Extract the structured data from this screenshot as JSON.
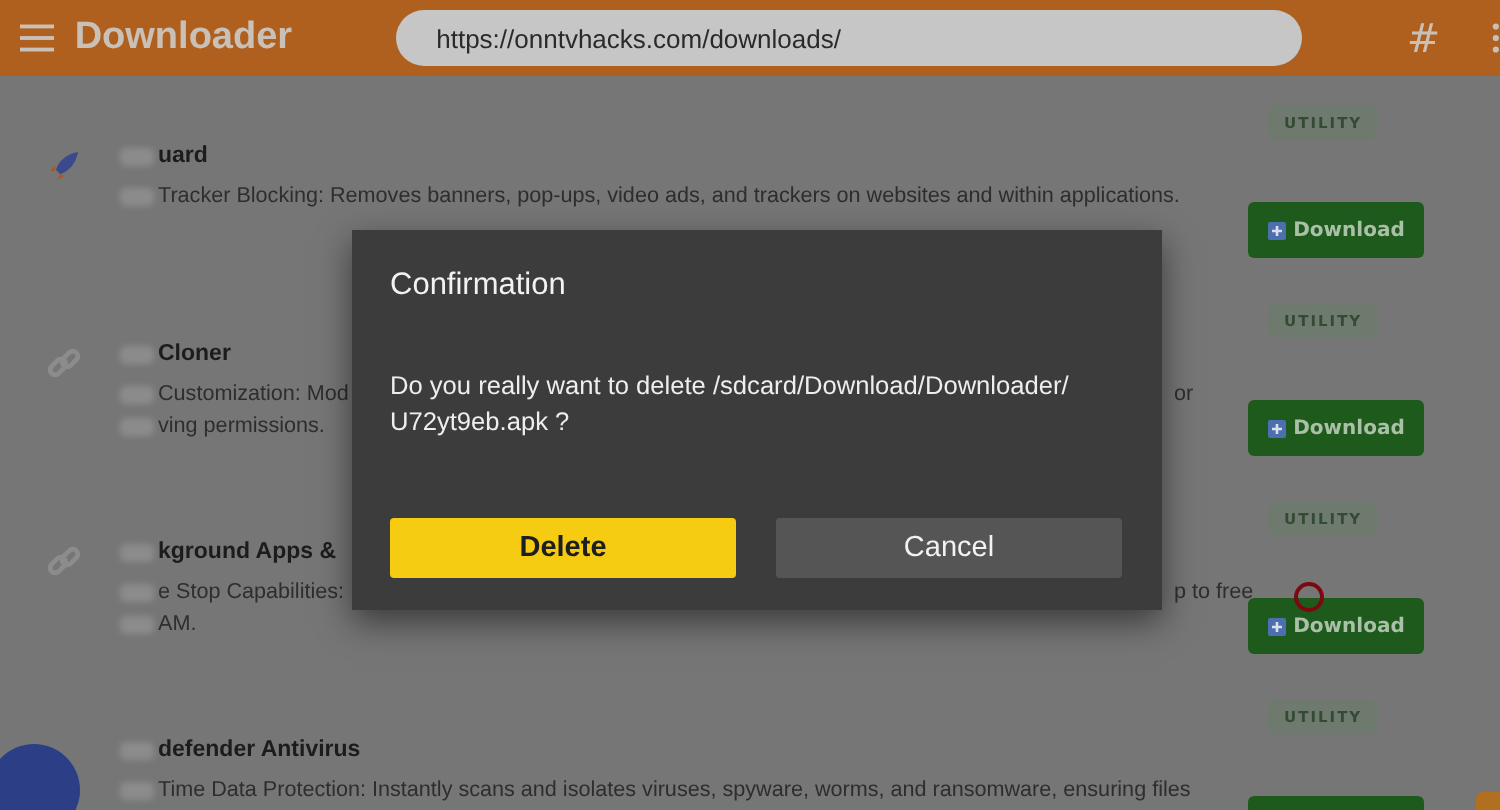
{
  "header": {
    "title": "Downloader",
    "url": "https://onntvhacks.com/downloads/",
    "hash": "#"
  },
  "apps": [
    {
      "kind": "rocket",
      "name": "uard",
      "desc_left": [
        "Tracker Blocking: Removes banners, pop-ups, video ads, and trackers on websites and within applications."
      ],
      "tag": "UTILITY",
      "button": "Download"
    },
    {
      "kind": "link",
      "name": "Cloner",
      "desc_left": [
        "Customization: Mod",
        "ving permissions."
      ],
      "desc_right": [
        "or"
      ],
      "tag": "UTILITY",
      "button": "Download"
    },
    {
      "kind": "link",
      "name": "kground Apps &",
      "desc_left": [
        "e Stop Capabilities:",
        "AM."
      ],
      "desc_right": [
        "p to free"
      ],
      "tag": "UTILITY",
      "button": "Download"
    },
    {
      "kind": "plain",
      "name": "defender Antivirus",
      "desc_left": [
        "Time Data Protection: Instantly scans and isolates viruses, spyware, worms, and ransomware, ensuring files"
      ],
      "tag": "UTILITY"
    }
  ],
  "dialog": {
    "title": "Confirmation",
    "message": "Do you really want to delete /sdcard/Download/Downloader/ U72yt9eb.apk ?",
    "buttons": [
      {
        "label": "Delete",
        "kind": "primary"
      },
      {
        "label": "Cancel",
        "kind": "secondary"
      }
    ]
  }
}
